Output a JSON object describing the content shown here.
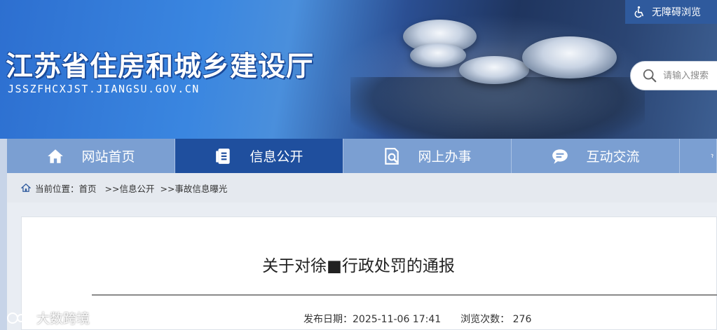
{
  "header": {
    "site_title": "江苏省住房和城乡建设厅",
    "site_domain": "JSSZFHCXJST.JIANGSU.GOV.CN",
    "accessibility_label": "无障碍浏览",
    "search_placeholder": "请输入搜索"
  },
  "nav": {
    "items": [
      {
        "label": "网站首页",
        "icon": "home-icon",
        "active": false
      },
      {
        "label": "信息公开",
        "icon": "document-icon",
        "active": true
      },
      {
        "label": "网上办事",
        "icon": "search-document-icon",
        "active": false
      },
      {
        "label": "互动交流",
        "icon": "chat-icon",
        "active": false
      }
    ]
  },
  "breadcrumb": {
    "prefix": "当前位置：",
    "items": [
      "首页",
      ">>信息公开",
      ">>事故信息曝光"
    ]
  },
  "article": {
    "title": "关于对徐■行政处罚的通报",
    "publish_label": "发布日期：",
    "publish_date": "2025-11-06 17:41",
    "views_label": "浏览次数：",
    "views": "276"
  },
  "watermark": {
    "text": "大数跨境"
  },
  "colors": {
    "nav_bg": "#7b9fd2",
    "nav_active": "#1f4f9e",
    "banner_blue": "#2d6fd0"
  }
}
